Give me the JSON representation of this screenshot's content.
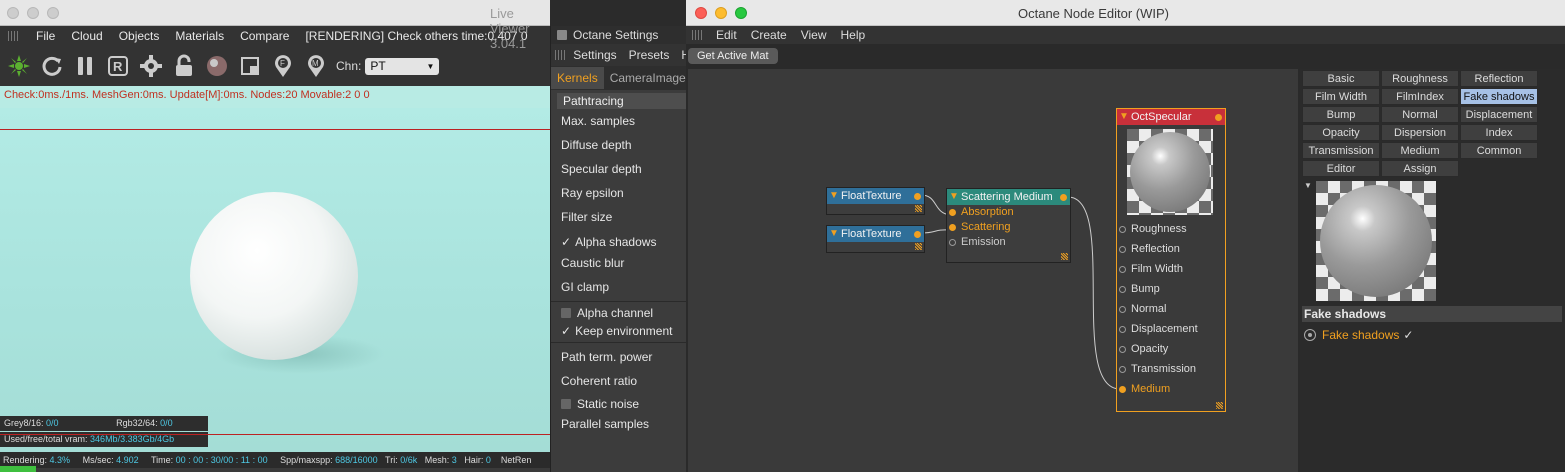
{
  "live_viewer": {
    "title": "Live Viewer 3.04.1",
    "menu": [
      "File",
      "Cloud",
      "Objects",
      "Materials",
      "Compare"
    ],
    "status_render": "[RENDERING] Check others time:0.407  0",
    "channel_label": "Chn:",
    "channel_value": "PT",
    "check_line": "Check:0ms./1ms. MeshGen:0ms. Update[M]:0ms. Nodes:20 Movable:2  0 0",
    "grey_label": "Grey8/16:",
    "grey_value": "0/0",
    "rgb_label": "Rgb32/64:",
    "rgb_value": "0/0",
    "vram_label": "Used/free/total vram:",
    "vram_value": "346Mb/3.383Gb/4Gb",
    "bottom": {
      "rendering_label": "Rendering:",
      "rendering_value": "4.3%",
      "mssec_label": "Ms/sec:",
      "mssec_value": "4.902",
      "time_label": "Time:",
      "time_value": "00 : 00 : 30/00 : 11 : 00",
      "spp_label": "Spp/maxspp:",
      "spp_value": "688/16000",
      "tri_label": "Tri:",
      "tri_value": "0/6k",
      "mesh_label": "Mesh:",
      "mesh_value": "3",
      "hair_label": "Hair:",
      "hair_value": "0",
      "netren": "NetRen"
    }
  },
  "octane_settings": {
    "title": "Octane Settings",
    "menu": [
      "Settings",
      "Presets",
      "H"
    ],
    "tabs": [
      "Kernels",
      "CameraImager"
    ],
    "kernel": "Pathtracing",
    "rows": [
      "Max. samples",
      "Diffuse depth",
      "Specular depth",
      "Ray epsilon",
      "Filter size",
      "Alpha shadows",
      "Caustic blur",
      "GI clamp",
      "Alpha channel",
      "Keep environment",
      "Path term. power",
      "Coherent ratio",
      "Static noise",
      "Parallel samples"
    ],
    "checked": {
      "alpha_shadows": true,
      "alpha_channel": false,
      "keep_environment": true,
      "static_noise": false
    }
  },
  "node_editor": {
    "title": "Octane Node Editor (WIP)",
    "menu": [
      "Edit",
      "Create",
      "View",
      "Help"
    ],
    "get_active_mat": "Get Active Mat",
    "nodes": {
      "float1": "FloatTexture",
      "float2": "FloatTexture",
      "scattering": {
        "title": "Scattering Medium",
        "ports": [
          "Absorption",
          "Scattering",
          "Emission"
        ]
      },
      "specular": {
        "title": "OctSpecular",
        "ports": [
          "Roughness",
          "Reflection",
          "Film Width",
          "Bump",
          "Normal",
          "Displacement",
          "Opacity",
          "Transmission",
          "Medium"
        ]
      }
    },
    "buttons": [
      "Basic",
      "Roughness",
      "Reflection",
      "Film Width",
      "FilmIndex",
      "Fake shadows",
      "Bump",
      "Normal",
      "Displacement",
      "Opacity",
      "Dispersion",
      "Index",
      "Transmission",
      "Medium",
      "Common",
      "Editor",
      "Assign"
    ],
    "selected_button": "Fake shadows",
    "section_title": "Fake shadows",
    "option_label": "Fake shadows",
    "option_checked": true
  },
  "colors": {
    "accent": "#f0a020",
    "node_header_blue": "#2f6f99",
    "node_header_teal": "#2c8a7c",
    "node_header_red": "#c8303a",
    "selected_btn": "#a6c1e6"
  }
}
